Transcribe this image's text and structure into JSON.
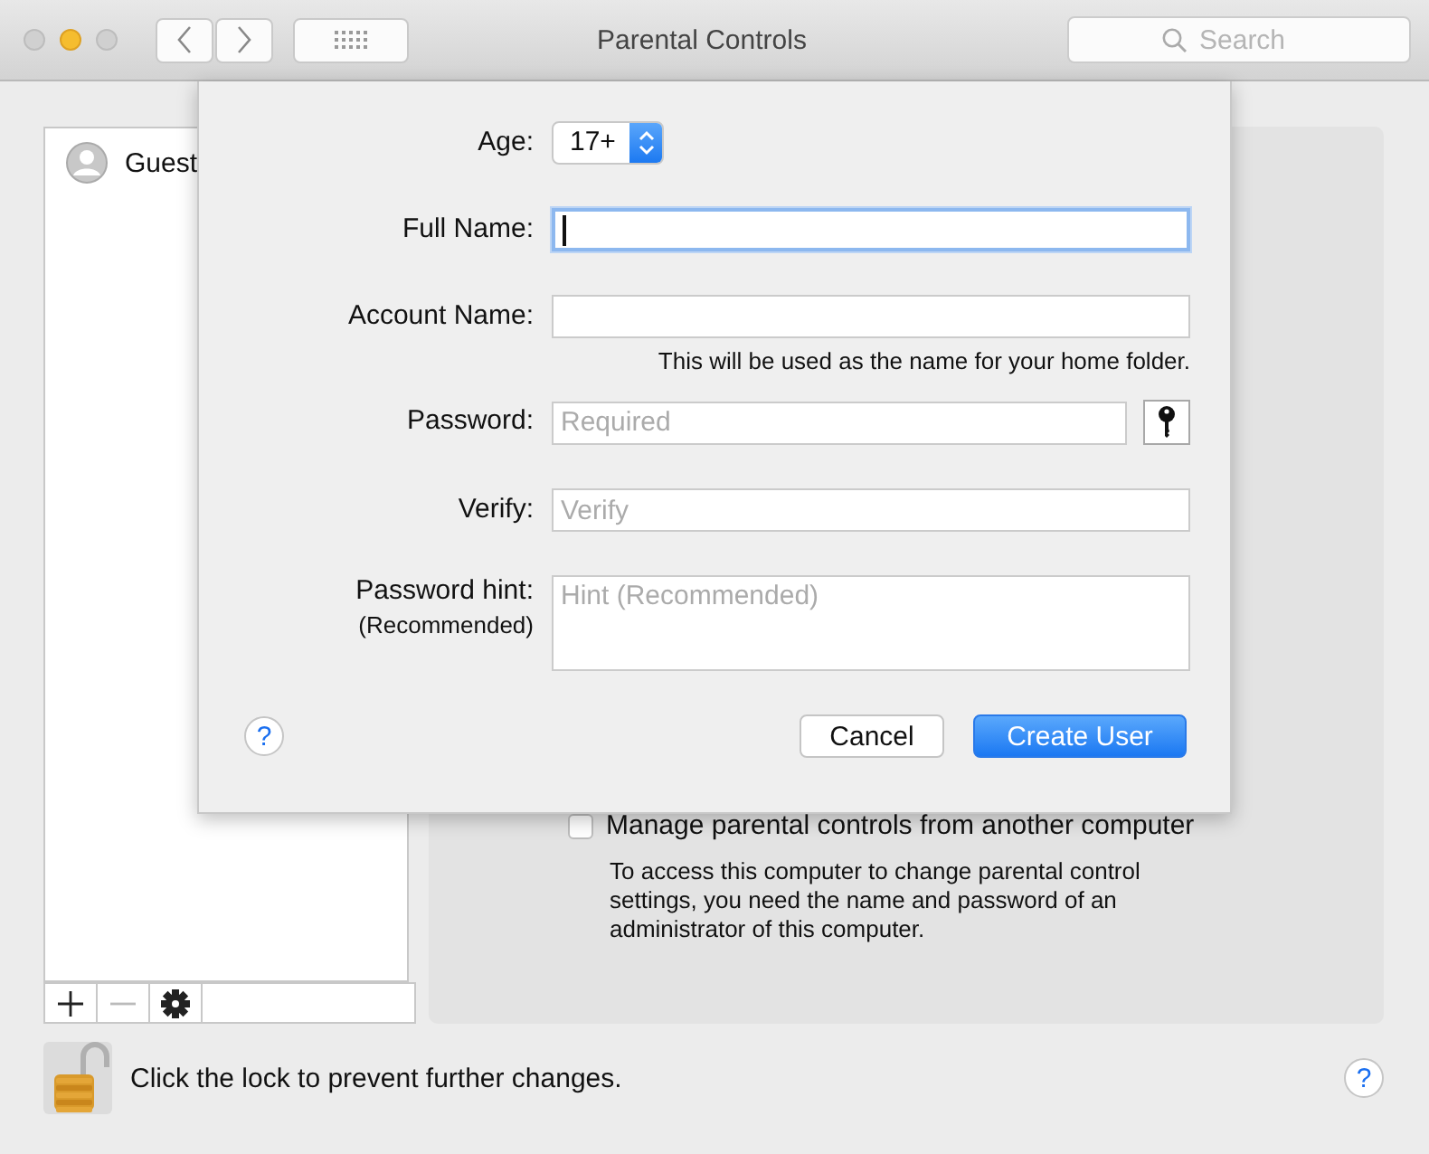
{
  "window": {
    "title": "Parental Controls",
    "search": {
      "placeholder": "Search"
    }
  },
  "users": [
    {
      "name": "Guest",
      "selected": false
    }
  ],
  "list_toolbar": [
    {
      "kind": "add",
      "disabled": false
    },
    {
      "kind": "remove",
      "disabled": true
    },
    {
      "kind": "action",
      "disabled": false
    }
  ],
  "remote": {
    "label": "Manage parental controls from another computer",
    "checked": false,
    "description": "To access this computer to change parental control settings, you need the name and password of an administrator of this computer."
  },
  "lock": {
    "text": "Click the lock to prevent further changes.",
    "locked": false
  },
  "help_button": "?",
  "sheet": {
    "age": {
      "label": "Age:",
      "value": "17+"
    },
    "fields": [
      {
        "kind": "text",
        "label": "Full Name:",
        "focused": true
      },
      {
        "kind": "text",
        "label": "Account Name:",
        "focused": false,
        "note": "This will be used as the name for your home folder."
      },
      {
        "kind": "password",
        "label": "Password:",
        "placeholder": "Required",
        "focused": false
      },
      {
        "kind": "text",
        "label": "Verify:",
        "placeholder": "Verify",
        "focused": false
      },
      {
        "kind": "multiline",
        "label": "Password hint:",
        "sublabel": "(Recommended)",
        "placeholder": "Hint (Recommended)",
        "focused": false
      }
    ],
    "help_button": "?",
    "buttons": [
      {
        "label": "Cancel",
        "default": false
      },
      {
        "label": "Create User",
        "default": true
      }
    ]
  }
}
